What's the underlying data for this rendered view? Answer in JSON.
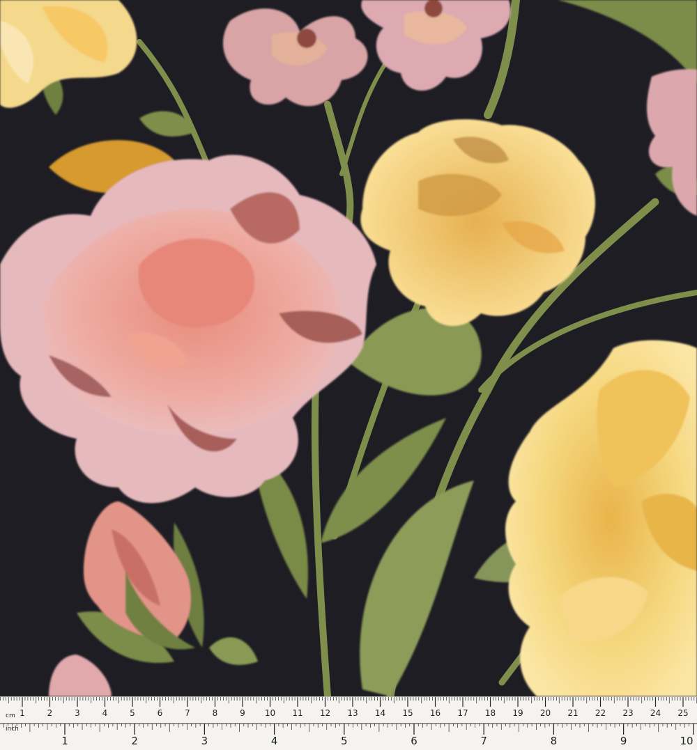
{
  "ruler": {
    "cm_unit": "cm",
    "inch_unit": "inch",
    "cm_labels": [
      "1",
      "2",
      "3",
      "4",
      "5",
      "6",
      "7",
      "8",
      "9",
      "10",
      "11",
      "12",
      "13",
      "14",
      "15",
      "16",
      "17",
      "18",
      "19",
      "20",
      "21",
      "22",
      "23",
      "24",
      "25"
    ],
    "inch_labels": [
      "1",
      "2",
      "3",
      "4",
      "5",
      "6",
      "7",
      "8",
      "9",
      "10"
    ]
  },
  "colors": {
    "background": "#1e1d24",
    "leaf": "#7a8a48",
    "pink_flower": "#e7a59c",
    "yellow_flower": "#f3cf70",
    "ruler_paper": "#f4f3ef"
  }
}
